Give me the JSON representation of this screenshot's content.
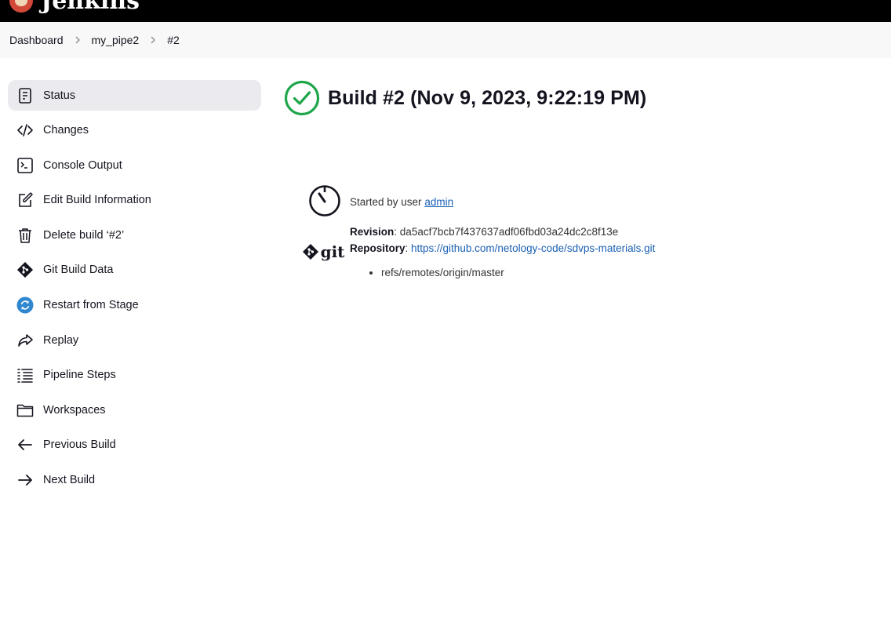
{
  "header": {
    "brand": "Jenkins"
  },
  "breadcrumb": [
    "Dashboard",
    "my_pipe2",
    "#2"
  ],
  "sidebar": {
    "items": [
      {
        "label": "Status",
        "icon": "document-icon",
        "active": true
      },
      {
        "label": "Changes",
        "icon": "code-icon"
      },
      {
        "label": "Console Output",
        "icon": "terminal-icon"
      },
      {
        "label": "Edit Build Information",
        "icon": "edit-icon"
      },
      {
        "label": "Delete build ‘#2’",
        "icon": "trash-icon"
      },
      {
        "label": "Git Build Data",
        "icon": "git-icon"
      },
      {
        "label": "Restart from Stage",
        "icon": "restart-icon"
      },
      {
        "label": "Replay",
        "icon": "replay-icon"
      },
      {
        "label": "Pipeline Steps",
        "icon": "list-icon"
      },
      {
        "label": "Workspaces",
        "icon": "folder-icon"
      },
      {
        "label": "Previous Build",
        "icon": "arrow-left-icon"
      },
      {
        "label": "Next Build",
        "icon": "arrow-right-icon"
      }
    ]
  },
  "main": {
    "title": "Build #2 (Nov 9, 2023, 9:22:19 PM)",
    "status_color": "#1ea64b",
    "started_prefix": "Started by user ",
    "started_user": "admin",
    "git_logo_text": "git",
    "revision_label": "Revision",
    "revision_value": "da5acf7bcb7f437637adf06fbd03a24dc2c8f13e",
    "repository_label": "Repository",
    "repository_url": "https://github.com/netology-code/sdvps-materials.git",
    "branches": [
      "refs/remotes/origin/master"
    ]
  }
}
